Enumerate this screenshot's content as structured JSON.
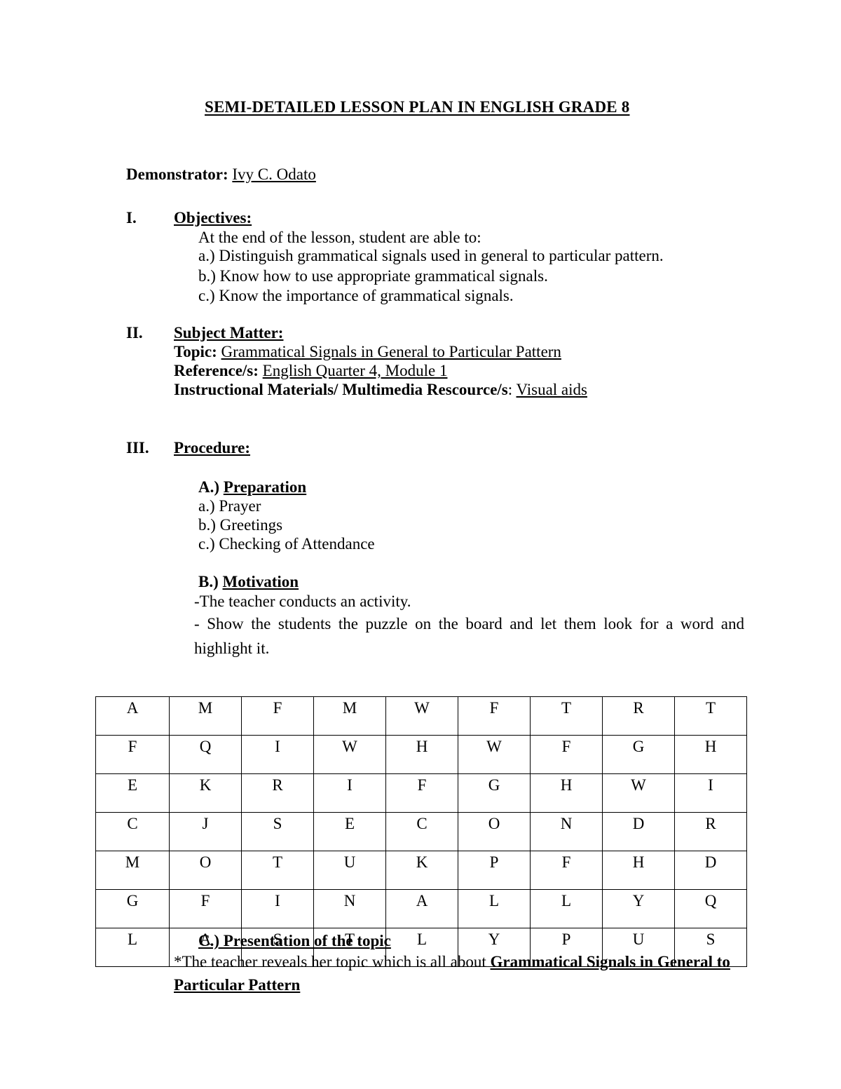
{
  "document": {
    "title": "SEMI-DETAILED LESSON PLAN IN ENGLISH GRADE 8",
    "demonstrator_label": "Demonstrator:",
    "demonstrator_name": "Ivy C. Odato"
  },
  "sections": {
    "objectives": {
      "numeral": "I.",
      "heading": "Objectives:",
      "intro": "At the end of the lesson, student are able to:",
      "items": [
        "a.) Distinguish grammatical signals used in general to particular pattern.",
        "b.) Know how to use appropriate grammatical signals.",
        "c.) Know the importance of grammatical signals."
      ]
    },
    "subject_matter": {
      "numeral": "II.",
      "heading": "Subject Matter:",
      "topic_label": "Topic:",
      "topic_value": "Grammatical Signals in General to Particular Pattern",
      "reference_label": "Reference/s:",
      "reference_value": "English Quarter 4, Module 1",
      "materials_label": "Instructional Materials/ Multimedia Rescource/s",
      "materials_colon": ":",
      "materials_value": "Visual aids"
    },
    "procedure": {
      "numeral": "III.",
      "heading": "Procedure: ",
      "preparation": {
        "letter": "A.)",
        "heading": "Preparation",
        "items": [
          "a.)  Prayer",
          "b.)  Greetings",
          "c.)  Checking of Attendance"
        ]
      },
      "motivation": {
        "letter": "B.)",
        "heading": "Motivation",
        "line1": "-The teacher conducts an activity.",
        "line2": "- Show the students the puzzle on the board and let them look for a word and highlight it."
      },
      "presentation": {
        "heading": "C.) Presentation of the topic",
        "text_prefix": "*The teacher reveals her topic which is all about ",
        "text_bold": "Grammatical Signals  in General to Particular Pattern"
      }
    }
  },
  "puzzle": {
    "rows": [
      [
        "A",
        "M",
        "F",
        "M",
        "W",
        "F",
        "T",
        "R",
        "T"
      ],
      [
        "F",
        "Q",
        "I",
        "W",
        "H",
        "W",
        "F",
        "G",
        "H"
      ],
      [
        "E",
        "K",
        "R",
        "I",
        "F",
        "G",
        "H",
        "W",
        "I"
      ],
      [
        "C",
        "J",
        "S",
        "E",
        "C",
        "O",
        "N",
        "D",
        "R"
      ],
      [
        "M",
        "O",
        "T",
        "U",
        "K",
        "P",
        "F",
        "H",
        "D"
      ],
      [
        "G",
        "F",
        "I",
        "N",
        "A",
        "L",
        "L",
        "Y",
        "Q"
      ],
      [
        "L",
        "A",
        "S",
        "T",
        "L",
        "Y",
        "P",
        "U",
        "S"
      ]
    ]
  }
}
